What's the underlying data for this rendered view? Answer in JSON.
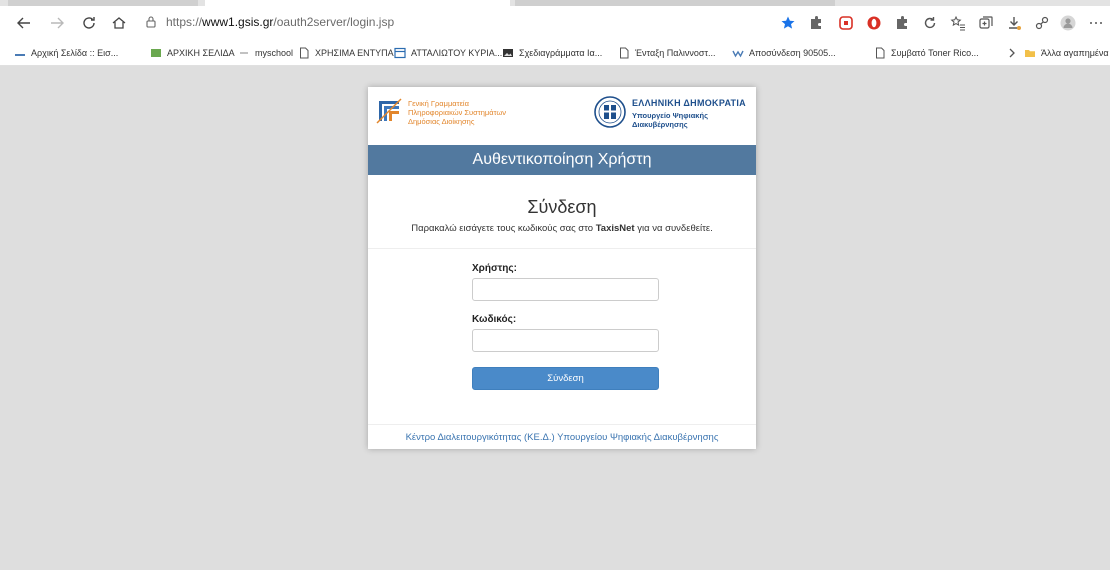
{
  "browser": {
    "url_scheme": "https://",
    "url_host": "www1.gsis.gr",
    "url_path": "/oauth2server/login.jsp",
    "bookmarks": [
      "Αρχική Σελίδα :: Εισ...",
      "ΑΡΧΙΚΗ ΣΕΛΙΔΑ",
      "myschool",
      "ΧΡΗΣΙΜΑ ΕΝΤΥΠΑ",
      "ΑΤΤΑΛΙΩΤΟΥ ΚΥΡΙΑ...",
      "Σχεδιαγράμματα Ια...",
      "Ένταξη Παλιννοστ...",
      "Αποσύνδεση 90505...",
      "Συμβατό Toner Rico..."
    ],
    "other_favorites": "Άλλα αγαπημένα",
    "colors": {
      "star": "#1a73e8",
      "red": "#d93025",
      "folder": "#f2c049"
    }
  },
  "header": {
    "gsis_lines": [
      "Γενική Γραμματεία",
      "Πληροφοριακών Συστημάτων",
      "Δημόσιας Διοίκησης"
    ],
    "gr_title": "ΕΛΛΗΝΙΚΗ ΔΗΜΟΚΡΑΤΙΑ",
    "gr_sub_lines": [
      "Υπουργείο Ψηφιακής",
      "Διακυβέρνησης"
    ]
  },
  "banner": {
    "title": "Αυθεντικοποίηση Χρήστη",
    "color": "#52799f"
  },
  "login": {
    "heading": "Σύνδεση",
    "instruction_before": "Παρακαλώ εισάγετε τους κωδικούς σας στο ",
    "instruction_brand": "TaxisNet",
    "instruction_after": " για να συνδεθείτε.",
    "username_label": "Χρήστης:",
    "username_value": "",
    "password_label": "Κωδικός:",
    "password_value": "",
    "submit_label": "Σύνδεση",
    "submit_color": "#4a8ac9"
  },
  "footer": {
    "link": "Κέντρο Διαλειτουργικότητας (ΚΕ.Δ.) Υπουργείου Ψηφιακής Διακυβέρνησης"
  }
}
